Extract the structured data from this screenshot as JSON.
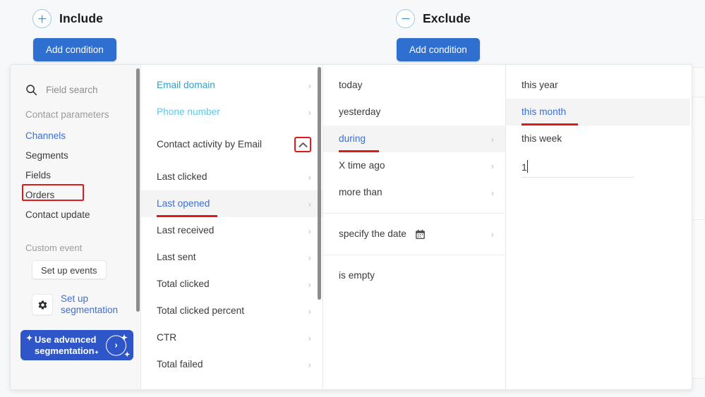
{
  "segments": {
    "include": {
      "title": "Include",
      "icon": "plus-circle-icon",
      "add_button": "Add condition"
    },
    "exclude": {
      "title": "Exclude",
      "icon": "minus-circle-icon",
      "add_button": "Add condition"
    }
  },
  "sidebar": {
    "search_placeholder": "Field search",
    "group_label": "Contact parameters",
    "items": [
      {
        "label": "Channels"
      },
      {
        "label": "Segments"
      },
      {
        "label": "Fields"
      },
      {
        "label": "Orders"
      },
      {
        "label": "Contact update"
      }
    ],
    "custom_event_label": "Custom event",
    "setup_events_button": "Set up events",
    "setup_segmentation_link": "Set up segmentation",
    "advanced_segmentation_button": "Use advanced segmentation"
  },
  "fields_column": {
    "items": [
      {
        "label": "Email domain"
      },
      {
        "label": "Phone number"
      },
      {
        "label": "Contact activity by Email"
      },
      {
        "label": "Last clicked"
      },
      {
        "label": "Last opened"
      },
      {
        "label": "Last received"
      },
      {
        "label": "Last sent"
      },
      {
        "label": "Total clicked"
      },
      {
        "label": "Total clicked percent"
      },
      {
        "label": "CTR"
      },
      {
        "label": "Total failed"
      }
    ]
  },
  "dates_column": {
    "items": [
      {
        "label": "today"
      },
      {
        "label": "yesterday"
      },
      {
        "label": "during"
      },
      {
        "label": "X time ago"
      },
      {
        "label": "more than"
      },
      {
        "label": "specify the date"
      },
      {
        "label": "is empty"
      }
    ]
  },
  "periods_column": {
    "items": [
      {
        "label": "this year"
      },
      {
        "label": "this month"
      },
      {
        "label": "this week"
      }
    ],
    "number_input_value": "1"
  },
  "colors": {
    "accent_blue": "#2f6fd0",
    "link_blue": "#3b6fd6",
    "highlight_red": "#e01a1a",
    "teal_link": "#34a0c4",
    "cyan_link": "#5bc8ea",
    "advanced_button": "#2f56c8"
  }
}
